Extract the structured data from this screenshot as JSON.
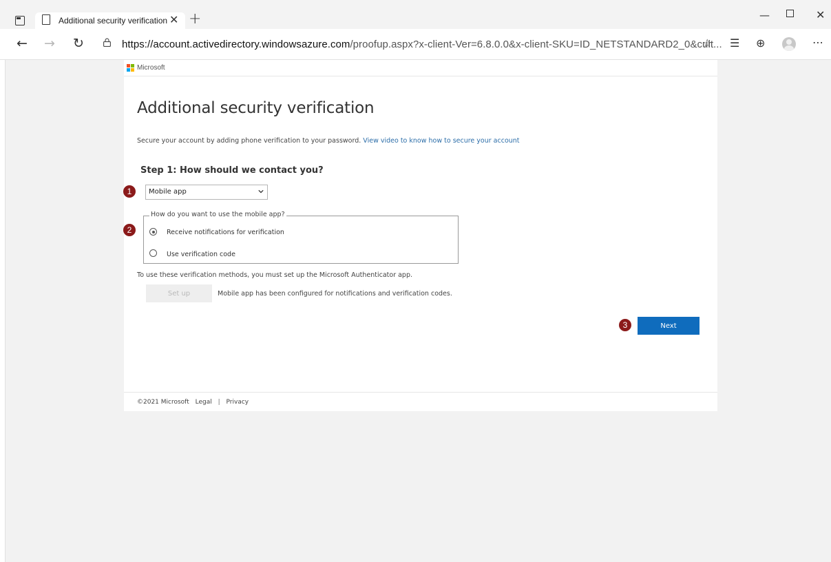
{
  "browser": {
    "tab_title": "Additional security verification",
    "tab_close": "✕",
    "new_tab": "+",
    "url_host": "https://account.activedirectory.windowsazure.com",
    "url_path": "/proofup.aspx?x-client-Ver=6.8.0.0&x-client-SKU=ID_NETSTANDARD2_0&cult...",
    "window_min": "—",
    "window_close": "✕",
    "icons": [
      "tab-actions-icon",
      "page-icon",
      "back-icon",
      "forward-icon",
      "refresh-icon",
      "lock-icon",
      "add-favorite-icon",
      "favorites-icon",
      "collections-icon",
      "profile-avatar",
      "more-icon"
    ]
  },
  "page": {
    "brand": "Microsoft",
    "title": "Additional security verification",
    "intro_text": "Secure your account by adding phone verification to your password.",
    "intro_link": "View video to know how to secure your account",
    "step_title": "Step 1: How should we contact you?",
    "contact_method": {
      "selected": "Mobile app"
    },
    "mobile_app_group": {
      "legend": "How do you want to use the mobile app?",
      "options": [
        {
          "label": "Receive notifications for verification",
          "checked": true
        },
        {
          "label": "Use verification code",
          "checked": false
        }
      ]
    },
    "authenticator_note": "To use these verification methods, you must set up the Microsoft Authenticator app.",
    "setup_button": "Set up",
    "setup_status": "Mobile app has been configured for notifications and verification codes.",
    "next_button": "Next",
    "footer": {
      "copyright": "©2021 Microsoft",
      "legal": "Legal",
      "separator": "|",
      "privacy": "Privacy"
    }
  },
  "callouts": [
    "1",
    "2",
    "3"
  ],
  "colors": {
    "primary_button": "#0f6cbd",
    "link": "#2b6da8",
    "callout": "#8b1a1a",
    "page_background": "#f2f2f2"
  }
}
